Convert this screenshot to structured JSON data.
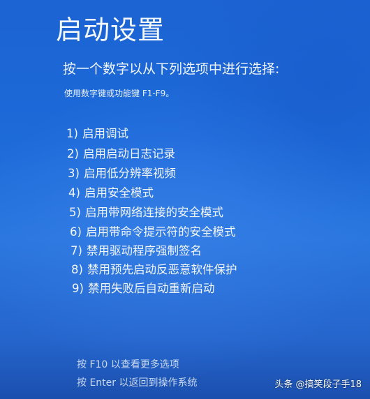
{
  "screen": {
    "title": "启动设置",
    "prompt": "按一个数字以从下列选项中进行选择:",
    "hint": "使用数字键或功能键 F1-F9。"
  },
  "options": [
    {
      "num": "1)",
      "label": "启用调试"
    },
    {
      "num": "2)",
      "label": "启用启动日志记录"
    },
    {
      "num": "3)",
      "label": "启用低分辨率视频"
    },
    {
      "num": "4)",
      "label": "启用安全模式"
    },
    {
      "num": "5)",
      "label": "启用带网络连接的安全模式"
    },
    {
      "num": "6)",
      "label": "启用带命令提示符的安全模式"
    },
    {
      "num": "7)",
      "label": "禁用驱动程序强制签名"
    },
    {
      "num": "8)",
      "label": "禁用预先启动反恶意软件保护"
    },
    {
      "num": "9)",
      "label": "禁用失败后自动重新启动"
    }
  ],
  "footer": {
    "more_options": "按 F10 以查看更多选项",
    "return_os": "按 Enter 以返回到操作系统"
  },
  "watermark": {
    "text": "头条 @搞笑段子手18"
  },
  "colors": {
    "background": "#1d6ad9",
    "text": "#ffffff",
    "footer_text": "#c9d9f2"
  }
}
